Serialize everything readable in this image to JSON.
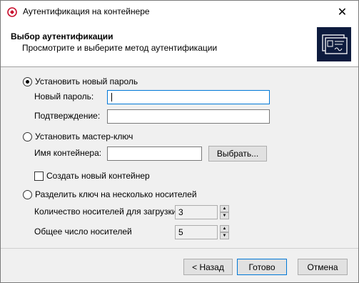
{
  "window": {
    "title": "Аутентификация на контейнере",
    "close_glyph": "✕"
  },
  "banner": {
    "title": "Выбор аутентификации",
    "subtitle": "Просмотрите и выберите метод аутентификации"
  },
  "options": {
    "new_password": {
      "label": "Установить новый пароль",
      "selected": true,
      "new_password_label": "Новый пароль:",
      "new_password_value": "",
      "confirm_label": "Подтверждение:",
      "confirm_value": ""
    },
    "master_key": {
      "label": "Установить мастер-ключ",
      "selected": false,
      "container_label": "Имя контейнера:",
      "container_value": "",
      "browse_label": "Выбрать...",
      "create_new_label": "Создать новый контейнер",
      "create_new_checked": false
    },
    "split_key": {
      "label": "Разделить ключ на несколько носителей",
      "selected": false,
      "load_count_label": "Количество носителей для загрузки",
      "load_count_value": "3",
      "total_count_label": "Общее число носителей",
      "total_count_value": "5"
    }
  },
  "footer": {
    "back_label": "< Назад",
    "done_label": "Готово",
    "cancel_label": "Отмена"
  },
  "icons": {
    "app": "cryptopro-app-icon",
    "banner": "certificate-card-icon",
    "spin_up": "▲",
    "spin_down": "▼"
  },
  "colors": {
    "accent": "#0078d7",
    "banner_icon_bg": "#0d1b3e",
    "app_icon_red": "#c8102e"
  }
}
